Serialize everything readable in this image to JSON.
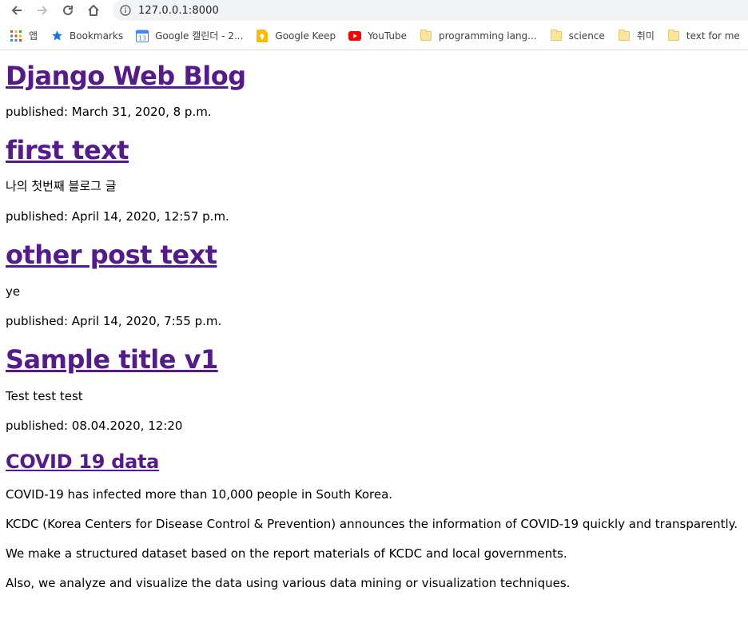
{
  "browser": {
    "url": "127.0.0.1:8000",
    "bookmarks": [
      {
        "label": "앱",
        "icon": "apps-grid-icon"
      },
      {
        "label": "Bookmarks",
        "icon": "star-icon"
      },
      {
        "label": "Google 캘린더 - 2...",
        "icon": "calendar-icon"
      },
      {
        "label": "Google Keep",
        "icon": "keep-icon"
      },
      {
        "label": "YouTube",
        "icon": "youtube-icon"
      },
      {
        "label": "programming lang...",
        "icon": "folder-icon"
      },
      {
        "label": "science",
        "icon": "folder-icon"
      },
      {
        "label": "취미",
        "icon": "folder-icon"
      },
      {
        "label": "text for me",
        "icon": "folder-icon"
      }
    ],
    "calendar_badge": "13"
  },
  "page": {
    "site_title": "Django Web Blog",
    "site_published": "published: March 31, 2020, 8 p.m.",
    "posts": [
      {
        "title": "first text",
        "body": [
          "나의 첫번째 블로그 글"
        ],
        "published": "published: April 14, 2020, 12:57 p.m."
      },
      {
        "title": "other post text",
        "body": [
          "ye"
        ],
        "published": "published: April 14, 2020, 7:55 p.m."
      },
      {
        "title": "Sample title v1",
        "body": [
          "Test test test"
        ],
        "published": "published: 08.04.2020, 12:20"
      }
    ],
    "covid": {
      "title": "COVID 19 data",
      "paragraphs": [
        "COVID-19 has infected more than 10,000 people in South Korea.",
        "KCDC (Korea Centers for Disease Control & Prevention) announces the information of COVID-19 quickly and transparently.",
        "We make a structured dataset based on the report materials of KCDC and local governments.",
        "Also, we analyze and visualize the data using various data mining or visualization techniques."
      ]
    }
  },
  "colors": {
    "link_visited": "#551a8b",
    "omnibox_bg": "#f1f3f4",
    "youtube_red": "#ff0000",
    "star_blue": "#1a73e8",
    "keep_yellow": "#fbbc04"
  }
}
